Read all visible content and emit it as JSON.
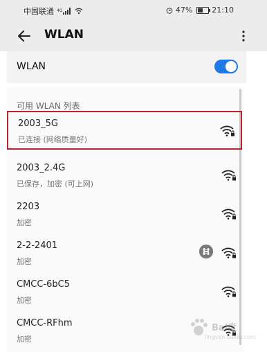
{
  "status_bar": {
    "carrier": "中国联通",
    "network_badge": "4G",
    "battery_percent": "47%",
    "battery_level": 0.47,
    "time": "21:10",
    "icons": [
      "signal-icon",
      "wifi-icon",
      "alarm-icon",
      "battery-icon"
    ]
  },
  "app_bar": {
    "title": "WLAN",
    "back_icon": "back-arrow-icon",
    "more_icon": "more-vert-icon"
  },
  "toggle": {
    "label": "WLAN",
    "on": true,
    "color": "#1e78e6"
  },
  "list": {
    "header": "可用 WLAN 列表",
    "networks": [
      {
        "name": "2003_5G",
        "status": "已连接 (网络质量好)",
        "highlighted": true
      },
      {
        "name": "2003_2.4G",
        "status": "已保存，加密 (可上网)"
      },
      {
        "name": "2203",
        "status": "加密"
      },
      {
        "name": "2-2-2401",
        "status": "加密",
        "hotspot_icon": true
      },
      {
        "name": "CMCC-6bC5",
        "status": "加密"
      },
      {
        "name": "CMCC-RFhm",
        "status": "加密"
      }
    ]
  },
  "highlight_color": "#b8232e",
  "watermark": {
    "text": "Bai度",
    "subtext": "jingyan.baidu.com"
  }
}
